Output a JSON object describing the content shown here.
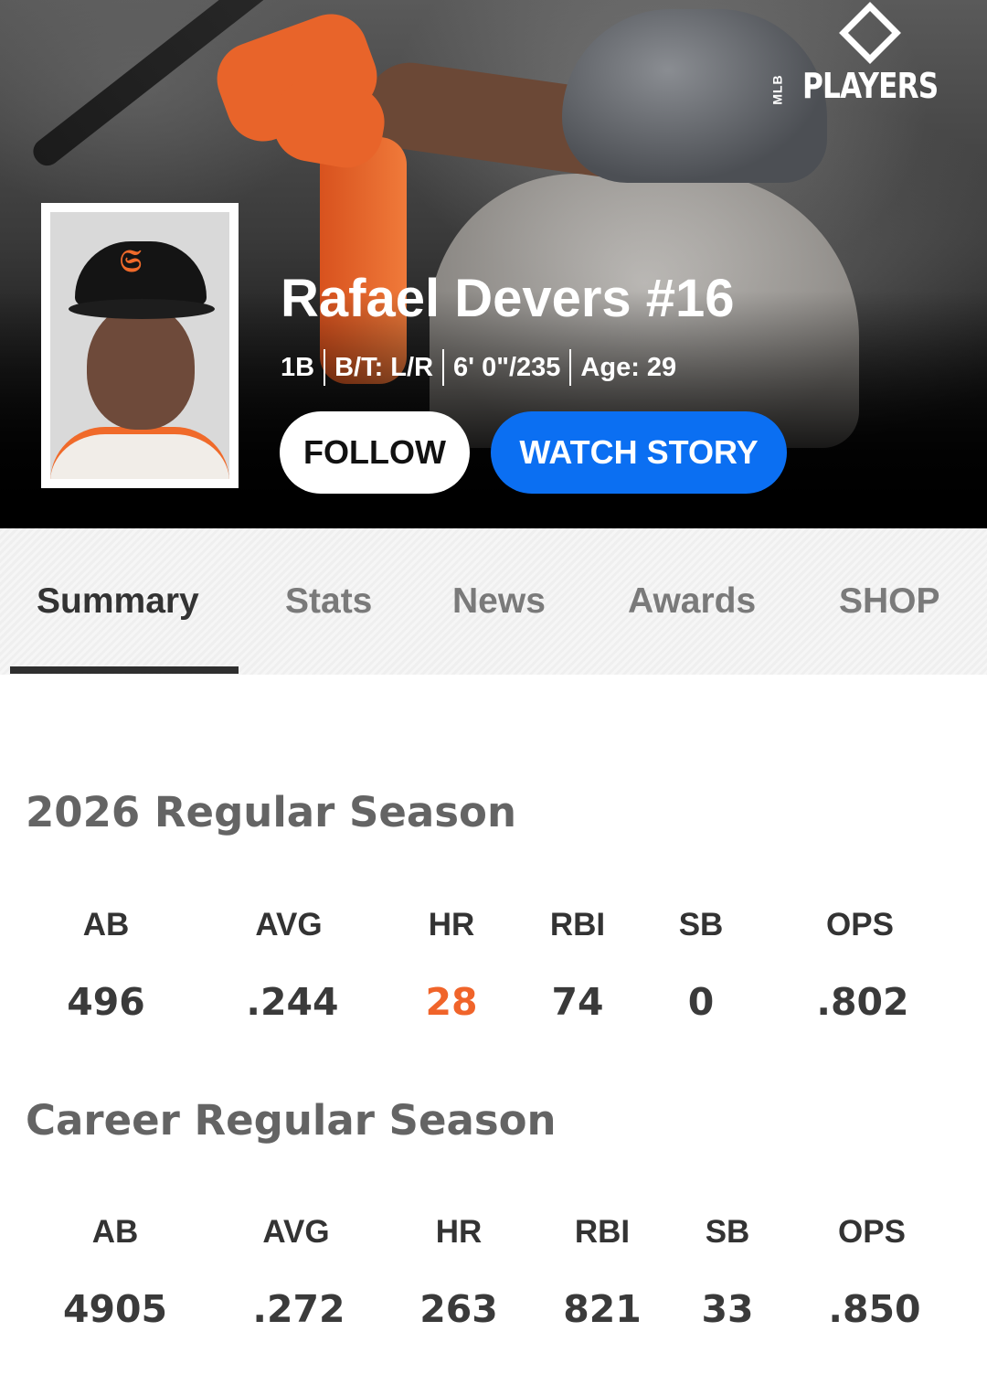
{
  "hero": {
    "brand_logo": "MLB PLAYERS",
    "brand_small": "MLB",
    "brand_text": "PLAYERS",
    "player_name": "Rafael Devers #16",
    "meta": [
      "1B",
      "B/T: L/R",
      "6' 0\"/235",
      "Age: 29"
    ],
    "follow_label": "FOLLOW",
    "watch_label": "WATCH STORY",
    "colors": {
      "watch_button": "#0b6ff2",
      "follow_button": "#ffffff",
      "team_orange": "#f06a2a"
    }
  },
  "tabs": [
    {
      "label": "Summary",
      "active": true
    },
    {
      "label": "Stats",
      "active": false
    },
    {
      "label": "News",
      "active": false
    },
    {
      "label": "Awards",
      "active": false
    },
    {
      "label": "SHOP",
      "active": false
    }
  ],
  "season": {
    "title": "2026 Regular Season",
    "labels": [
      "AB",
      "AVG",
      "HR",
      "RBI",
      "SB",
      "OPS"
    ],
    "values": [
      "496",
      ".244",
      "28",
      "74",
      "0",
      ".802"
    ],
    "highlight_color": "#f0642a"
  },
  "career": {
    "title": "Career Regular Season",
    "labels": [
      "AB",
      "AVG",
      "HR",
      "RBI",
      "SB",
      "OPS"
    ],
    "values": [
      "4905",
      ".272",
      "263",
      "821",
      "33",
      ".850"
    ]
  }
}
